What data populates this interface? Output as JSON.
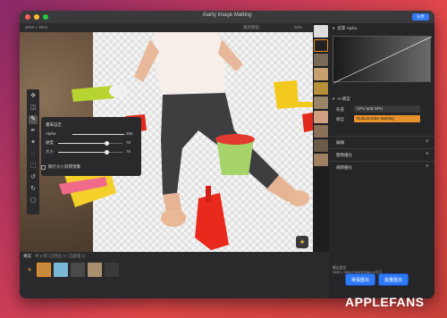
{
  "window": {
    "title": "Aiarty Image Matting",
    "share_label": "分享"
  },
  "subbar": {
    "dimensions": "3048 × 3504",
    "compare_label": "最新階段",
    "zoom": "38%"
  },
  "toolbar": {
    "tools": [
      "move-icon",
      "eraser-icon",
      "brush-icon",
      "pen-icon",
      "magic-icon",
      "lasso-icon",
      "select-icon",
      "undo-icon",
      "redo-icon",
      "rect-icon"
    ]
  },
  "brush_panel": {
    "title": "畫筆設定",
    "alpha_label": "Alpha",
    "alpha_value": "255",
    "alpha_level": 1.0,
    "hardness_label": "硬度",
    "hardness_value": "76",
    "hardness_level": 0.76,
    "size_label": "大小",
    "size_value": "76",
    "size_level": 0.76,
    "checkbox_label": "顯示大小游標預覽"
  },
  "bottombar": {
    "project_label": "專案",
    "count_text": "共 5 張 (已匯出 0 / 已處理 1)",
    "thumbnail_count": 5
  },
  "rightpanel": {
    "header": "遮罩 Alpha",
    "ai_label": "AI 模型",
    "device_label": "裝置",
    "device_value": "CPU and GPU",
    "model_label": "模型",
    "model_value": "RobustVideo Matting",
    "sections": [
      "編輯",
      "圖像優化",
      "細節優化"
    ]
  },
  "export": {
    "info_title": "匯出設定",
    "info_detail": "3048 × 3504 PNG(RGBA) 8 位元",
    "single_label": "單張匯出",
    "batch_label": "批量匯出"
  },
  "watermark": {
    "text1": "APPLE",
    "text2": "FANS"
  },
  "colors": {
    "accent": "#2f7bf5",
    "orange": "#e8932a",
    "close": "#ff5f57",
    "minimize": "#febc2e",
    "maximize": "#28c840"
  }
}
